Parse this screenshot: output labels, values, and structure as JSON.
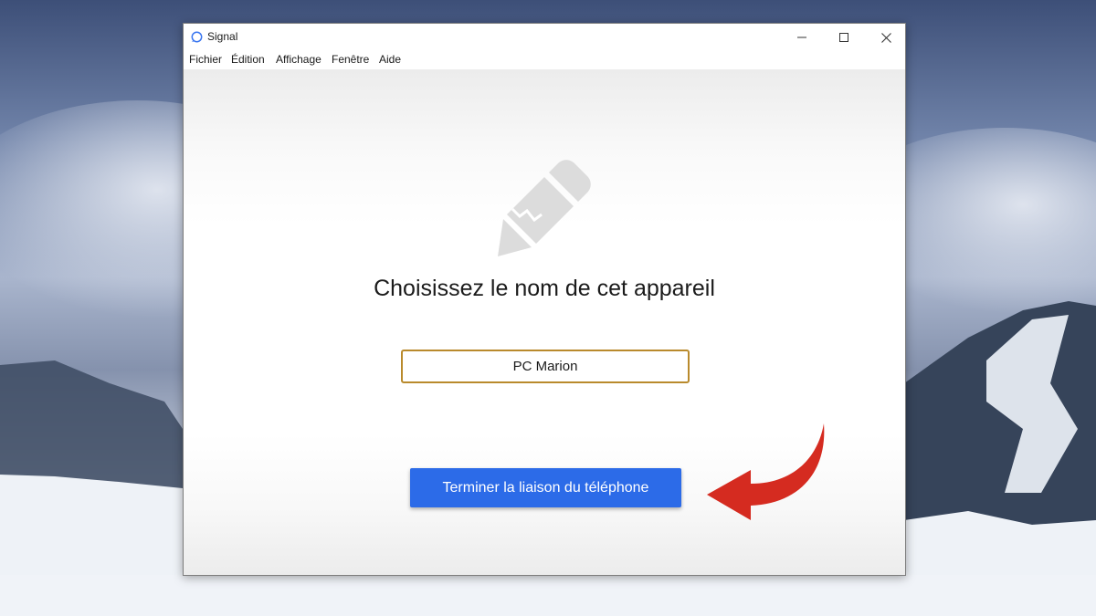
{
  "window": {
    "title": "Signal"
  },
  "menubar": {
    "items": [
      "Fichier",
      "Édition",
      "Affichage",
      "Fenêtre",
      "Aide"
    ]
  },
  "main": {
    "heading": "Choisissez le nom de cet appareil",
    "device_name_value": "PC Marion",
    "finish_button_label": "Terminer la liaison du téléphone"
  },
  "icons": {
    "app": "signal-logo-icon",
    "hero": "pencil-icon",
    "annotation": "red-curved-arrow-icon"
  },
  "colors": {
    "accent": "#2c6be8",
    "input_border": "#b98a2c",
    "annotation_arrow": "#d52b20"
  }
}
